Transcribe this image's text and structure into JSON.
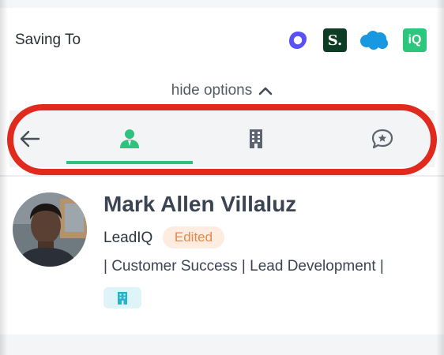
{
  "header": {
    "saving_label": "Saving To",
    "integrations": [
      {
        "icon": "outreach-icon",
        "color": "#5951f5"
      },
      {
        "icon": "salesloft-icon",
        "label": "S.",
        "color": "#0d3d24"
      },
      {
        "icon": "salesforce-icon",
        "color": "#1798e0"
      },
      {
        "icon": "leadiq-icon",
        "label": "iQ",
        "color": "#2dc67d"
      }
    ]
  },
  "options": {
    "hide_label": "hide options"
  },
  "tabs": [
    {
      "icon": "back-arrow-icon"
    },
    {
      "icon": "person-icon",
      "active": true
    },
    {
      "icon": "building-icon"
    },
    {
      "icon": "chat-star-icon"
    }
  ],
  "profile": {
    "name": "Mark Allen Villaluz",
    "company": "LeadIQ",
    "badge": "Edited",
    "title": "| Customer Success | Lead Development |",
    "company_chip_icon": "building-icon"
  },
  "colors": {
    "accent": "#2ec27e",
    "highlight": "#e02a1e",
    "badge_bg": "#fdecdf",
    "badge_text": "#e8894a"
  }
}
